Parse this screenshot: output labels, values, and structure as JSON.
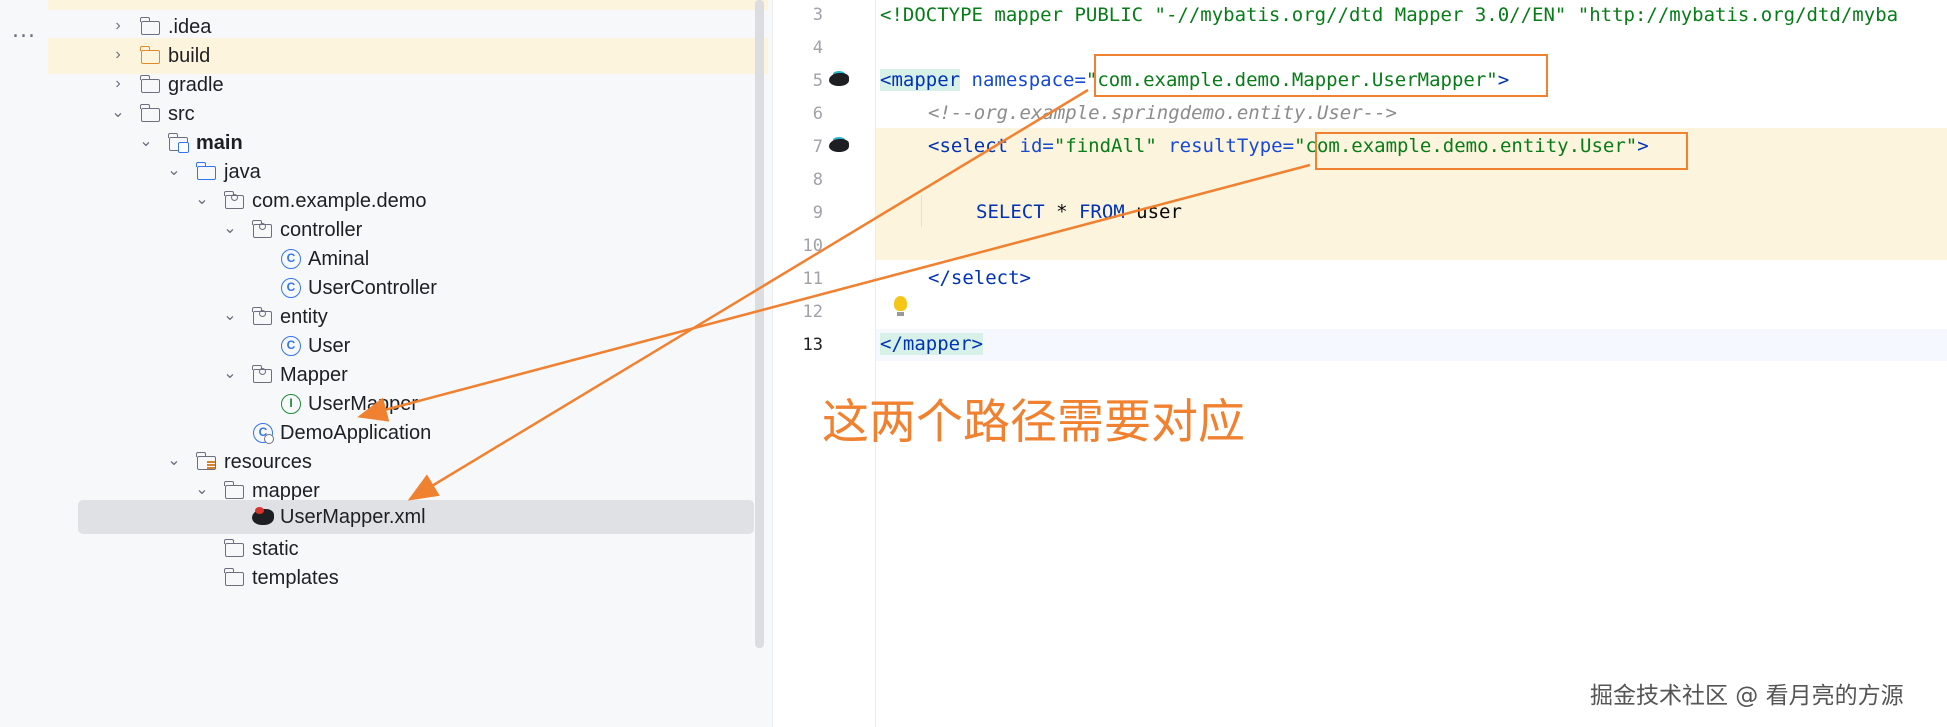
{
  "left_strip": {
    "more_label": "..."
  },
  "tree": {
    "items": [
      {
        "label": ".idea",
        "icon": "folder-icon",
        "expanded": false
      },
      {
        "label": "build",
        "icon": "folder-excluded-icon",
        "expanded": false
      },
      {
        "label": "gradle",
        "icon": "folder-icon",
        "expanded": false
      },
      {
        "label": "src",
        "icon": "folder-icon",
        "expanded": true
      },
      {
        "label": "main",
        "icon": "module-folder-icon",
        "expanded": true
      },
      {
        "label": "java",
        "icon": "source-folder-icon",
        "expanded": true
      },
      {
        "label": "com.example.demo",
        "icon": "package-icon",
        "expanded": true
      },
      {
        "label": "controller",
        "icon": "package-icon",
        "expanded": true
      },
      {
        "label": "Aminal",
        "icon": "class-icon",
        "badge": "C"
      },
      {
        "label": "UserController",
        "icon": "class-icon",
        "badge": "C"
      },
      {
        "label": "entity",
        "icon": "package-icon",
        "expanded": true
      },
      {
        "label": "User",
        "icon": "class-icon",
        "badge": "C"
      },
      {
        "label": "Mapper",
        "icon": "package-icon",
        "expanded": true
      },
      {
        "label": "UserMapper",
        "icon": "interface-icon",
        "badge": "I"
      },
      {
        "label": "DemoApplication",
        "icon": "spring-class-icon",
        "badge": "C"
      },
      {
        "label": "resources",
        "icon": "resources-folder-icon",
        "expanded": true
      },
      {
        "label": "mapper",
        "icon": "folder-icon",
        "expanded": true
      },
      {
        "label": "UserMapper.xml",
        "icon": "mybatis-xml-icon",
        "selected": true
      },
      {
        "label": "static",
        "icon": "folder-icon"
      },
      {
        "label": "templates",
        "icon": "folder-icon"
      }
    ]
  },
  "editor": {
    "line_numbers": [
      "3",
      "4",
      "5",
      "6",
      "7",
      "8",
      "9",
      "10",
      "11",
      "12",
      "13"
    ],
    "current_line": "13",
    "lines": {
      "l3": "<!DOCTYPE mapper PUBLIC \"-//mybatis.org//dtd Mapper 3.0//EN\" \"http://mybatis.org/dtd/myba",
      "l5_tag": "<mapper",
      "l5_attr": " namespace=",
      "l5_val": "\"com.example.demo.Mapper.UserMapper\"",
      "l5_end": ">",
      "l6": "<!--org.example.springdemo.entity.User-->",
      "l7_tag": "<select",
      "l7_attr1": " id=",
      "l7_val1": "\"findAll\"",
      "l7_attr2": " resultType=",
      "l7_val2": "\"com.example.demo.entity.User\"",
      "l7_end": ">",
      "l9_kw1": "SELECT",
      "l9_mid": " * ",
      "l9_kw2": "FROM",
      "l9_tail": " user",
      "l11": "</select>",
      "l13": "</mapper>"
    }
  },
  "annotation": {
    "note": "这两个路径需要对应",
    "color": "#f08130"
  },
  "watermark": "掘金技术社区 @ 看月亮的方源"
}
